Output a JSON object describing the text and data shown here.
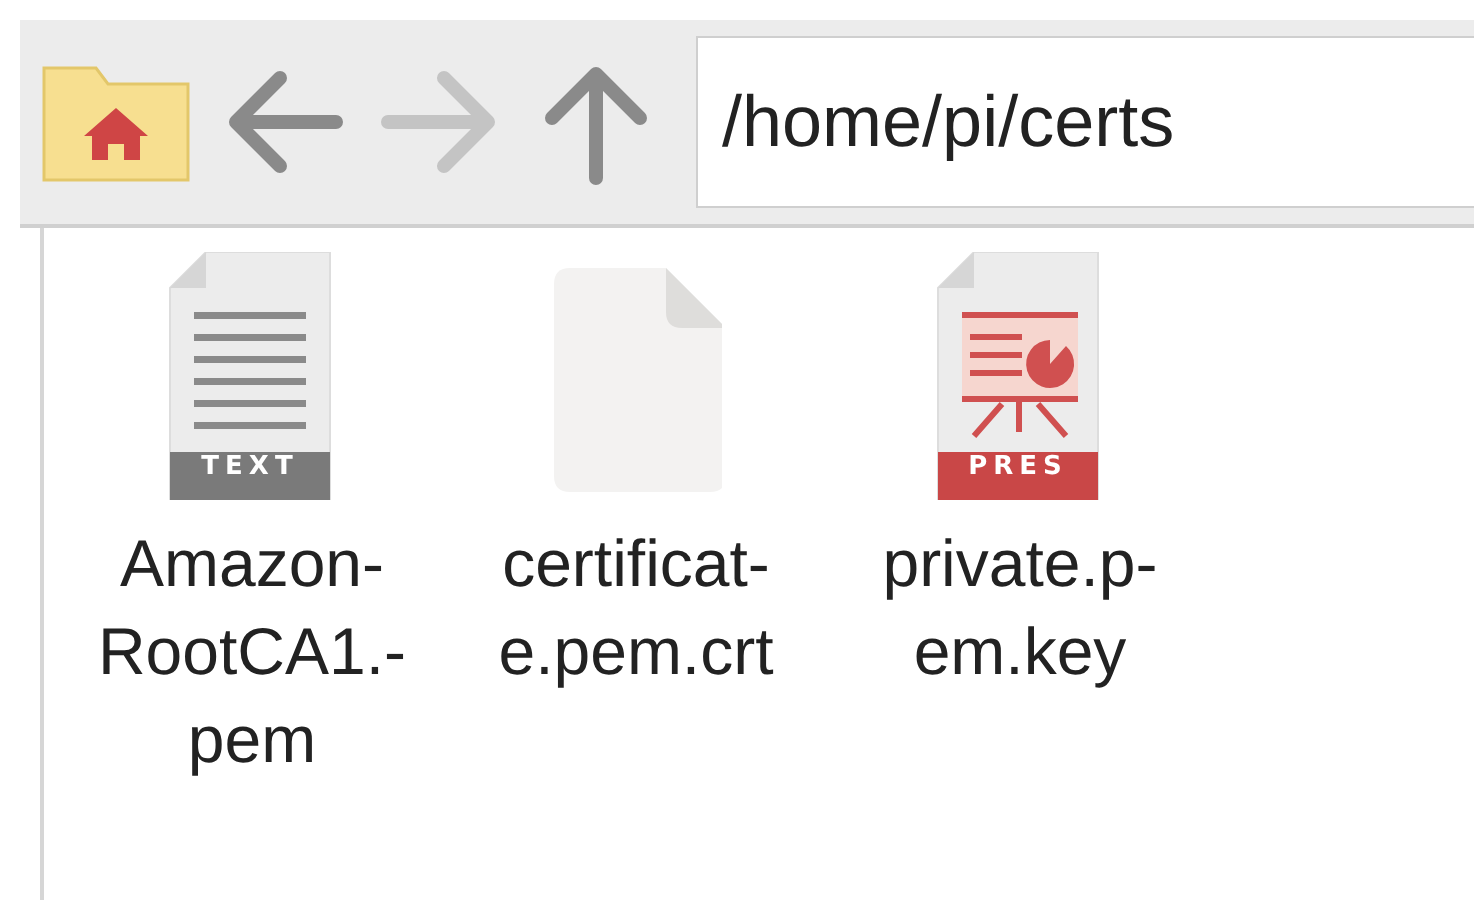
{
  "toolbar": {
    "back": {
      "disabled": false
    },
    "forward": {
      "disabled": true
    },
    "up": {
      "disabled": false
    },
    "path": "/home/pi/certs"
  },
  "files": [
    {
      "kind": "text",
      "badge": "TEXT",
      "name_lines": [
        "Amazon-",
        "RootCA1.-",
        "pem"
      ]
    },
    {
      "kind": "blank",
      "name_lines": [
        "certificat-",
        "e.pem.crt"
      ]
    },
    {
      "kind": "presentation",
      "badge": "PRES",
      "name_lines": [
        "private.p-",
        "em.key"
      ]
    }
  ]
}
